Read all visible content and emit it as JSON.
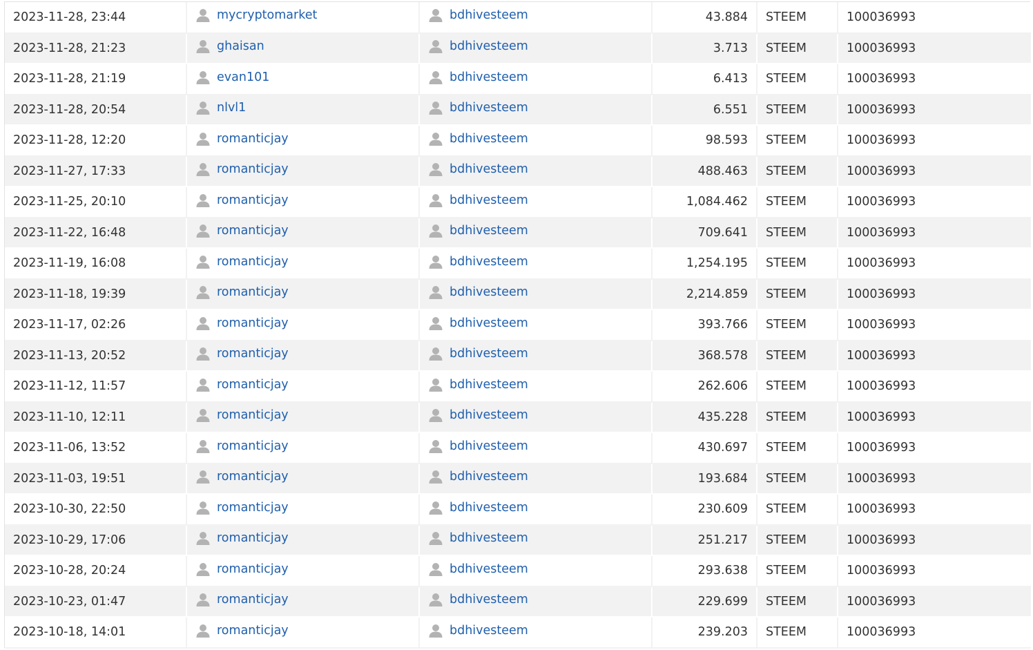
{
  "colors": {
    "link": "#1f5fad",
    "row_alt": "#f2f2f2",
    "text": "#333333",
    "icon": "#b3b3b3"
  },
  "icons": {
    "user": "user-icon"
  },
  "rows": [
    {
      "date": "2023-11-28, 23:44",
      "from": "mycryptomarket",
      "to": "bdhivesteem",
      "amount": "43.884",
      "asset": "STEEM",
      "memo": "100036993"
    },
    {
      "date": "2023-11-28, 21:23",
      "from": "ghaisan",
      "to": "bdhivesteem",
      "amount": "3.713",
      "asset": "STEEM",
      "memo": "100036993"
    },
    {
      "date": "2023-11-28, 21:19",
      "from": "evan101",
      "to": "bdhivesteem",
      "amount": "6.413",
      "asset": "STEEM",
      "memo": "100036993"
    },
    {
      "date": "2023-11-28, 20:54",
      "from": "nlvl1",
      "to": "bdhivesteem",
      "amount": "6.551",
      "asset": "STEEM",
      "memo": "100036993"
    },
    {
      "date": "2023-11-28, 12:20",
      "from": "romanticjay",
      "to": "bdhivesteem",
      "amount": "98.593",
      "asset": "STEEM",
      "memo": "100036993"
    },
    {
      "date": "2023-11-27, 17:33",
      "from": "romanticjay",
      "to": "bdhivesteem",
      "amount": "488.463",
      "asset": "STEEM",
      "memo": "100036993"
    },
    {
      "date": "2023-11-25, 20:10",
      "from": "romanticjay",
      "to": "bdhivesteem",
      "amount": "1,084.462",
      "asset": "STEEM",
      "memo": "100036993"
    },
    {
      "date": "2023-11-22, 16:48",
      "from": "romanticjay",
      "to": "bdhivesteem",
      "amount": "709.641",
      "asset": "STEEM",
      "memo": "100036993"
    },
    {
      "date": "2023-11-19, 16:08",
      "from": "romanticjay",
      "to": "bdhivesteem",
      "amount": "1,254.195",
      "asset": "STEEM",
      "memo": "100036993"
    },
    {
      "date": "2023-11-18, 19:39",
      "from": "romanticjay",
      "to": "bdhivesteem",
      "amount": "2,214.859",
      "asset": "STEEM",
      "memo": "100036993"
    },
    {
      "date": "2023-11-17, 02:26",
      "from": "romanticjay",
      "to": "bdhivesteem",
      "amount": "393.766",
      "asset": "STEEM",
      "memo": "100036993"
    },
    {
      "date": "2023-11-13, 20:52",
      "from": "romanticjay",
      "to": "bdhivesteem",
      "amount": "368.578",
      "asset": "STEEM",
      "memo": "100036993"
    },
    {
      "date": "2023-11-12, 11:57",
      "from": "romanticjay",
      "to": "bdhivesteem",
      "amount": "262.606",
      "asset": "STEEM",
      "memo": "100036993"
    },
    {
      "date": "2023-11-10, 12:11",
      "from": "romanticjay",
      "to": "bdhivesteem",
      "amount": "435.228",
      "asset": "STEEM",
      "memo": "100036993"
    },
    {
      "date": "2023-11-06, 13:52",
      "from": "romanticjay",
      "to": "bdhivesteem",
      "amount": "430.697",
      "asset": "STEEM",
      "memo": "100036993"
    },
    {
      "date": "2023-11-03, 19:51",
      "from": "romanticjay",
      "to": "bdhivesteem",
      "amount": "193.684",
      "asset": "STEEM",
      "memo": "100036993"
    },
    {
      "date": "2023-10-30, 22:50",
      "from": "romanticjay",
      "to": "bdhivesteem",
      "amount": "230.609",
      "asset": "STEEM",
      "memo": "100036993"
    },
    {
      "date": "2023-10-29, 17:06",
      "from": "romanticjay",
      "to": "bdhivesteem",
      "amount": "251.217",
      "asset": "STEEM",
      "memo": "100036993"
    },
    {
      "date": "2023-10-28, 20:24",
      "from": "romanticjay",
      "to": "bdhivesteem",
      "amount": "293.638",
      "asset": "STEEM",
      "memo": "100036993"
    },
    {
      "date": "2023-10-23, 01:47",
      "from": "romanticjay",
      "to": "bdhivesteem",
      "amount": "229.699",
      "asset": "STEEM",
      "memo": "100036993"
    },
    {
      "date": "2023-10-18, 14:01",
      "from": "romanticjay",
      "to": "bdhivesteem",
      "amount": "239.203",
      "asset": "STEEM",
      "memo": "100036993"
    }
  ]
}
